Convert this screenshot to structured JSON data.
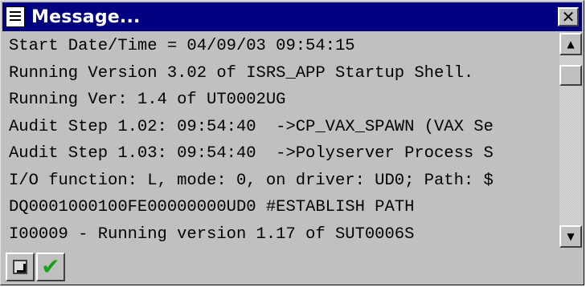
{
  "window": {
    "title": "Message...",
    "close_glyph": "✕"
  },
  "messages": [
    "Start Date/Time = 04/09/03 09:54:15",
    "Running Version 3.02 of ISRS_APP Startup Shell.",
    "Running Ver: 1.4 of UT0002UG",
    "Audit Step 1.02: 09:54:40  ->CP_VAX_SPAWN (VAX Se",
    "Audit Step 1.03: 09:54:40  ->Polyserver Process S",
    "I/O function: L, mode: 0, on driver: UD0; Path: $",
    "DQ0001000100FE00000000UD0 #ESTABLISH PATH",
    "I00009 - Running version 1.17 of SUT0006S"
  ],
  "scrollbar": {
    "up_glyph": "▲",
    "down_glyph": "▼"
  },
  "toolbar": {
    "check_glyph": "✔"
  },
  "icons": {
    "title": "document-icon",
    "close": "close-icon",
    "action_one": "arrow-box-icon",
    "action_two": "checkmark-icon"
  }
}
